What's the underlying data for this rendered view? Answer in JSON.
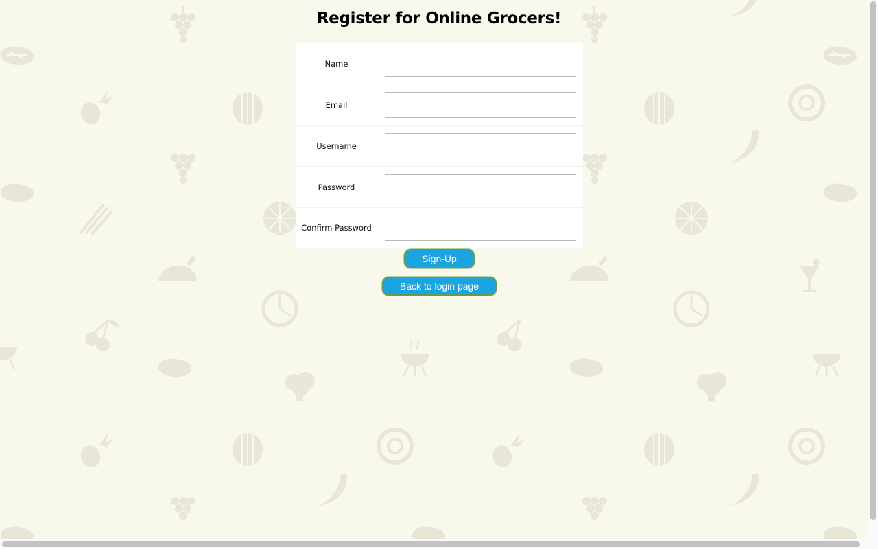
{
  "page": {
    "title": "Register for Online Grocers!"
  },
  "form": {
    "fields": [
      {
        "label": "Name",
        "value": ""
      },
      {
        "label": "Email",
        "value": ""
      },
      {
        "label": "Username",
        "value": ""
      },
      {
        "label": "Password",
        "value": ""
      },
      {
        "label": "Confirm Password",
        "value": ""
      }
    ]
  },
  "buttons": {
    "signup_label": "Sign-Up",
    "back_label": "Back to login page"
  },
  "theme": {
    "background": "#f9f8ec",
    "pattern_icon_color": "#e8e6d6",
    "button_color": "#1ca4e0",
    "button_border": "#5e9d52"
  },
  "background_pattern": {
    "icons": [
      "grapes-icon",
      "steak-icon",
      "pineapple-icon",
      "watermelon-icon",
      "donut-icon",
      "banana-icon",
      "asparagus-icon",
      "citrus-icon",
      "roast-chicken-icon",
      "pizza-icon",
      "cherries-icon",
      "grill-icon",
      "broccoli-icon",
      "cocktail-icon",
      "chili-icon"
    ]
  }
}
